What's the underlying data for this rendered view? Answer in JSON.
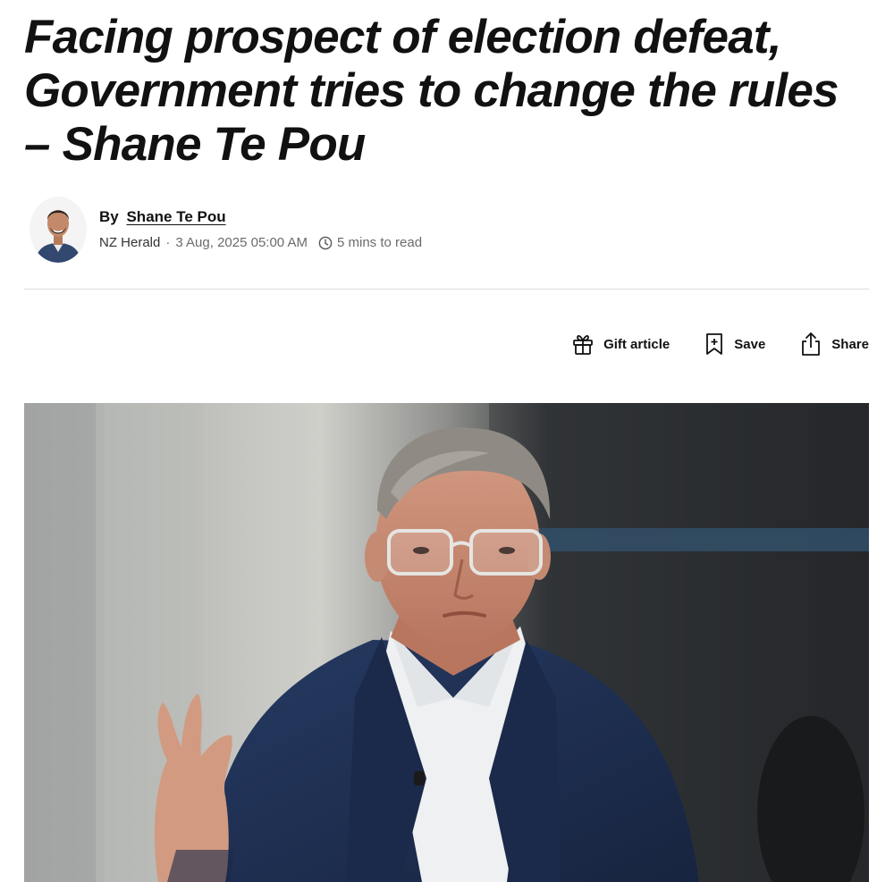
{
  "article": {
    "headline": "Facing prospect of election defeat, Government tries to change the rules – Shane Te Pou"
  },
  "byline": {
    "prefix": "By",
    "author": "Shane Te Pou",
    "source": "NZ Herald",
    "separator": "·",
    "date": "3 Aug, 2025 05:00 AM",
    "read_time": "5 mins to read"
  },
  "actions": {
    "gift_label": "Gift article",
    "save_label": "Save",
    "share_label": "Share"
  },
  "icons": {
    "gift": "gift-icon",
    "save": "bookmark-plus-icon",
    "share": "share-icon",
    "clock": "clock-icon"
  },
  "colors": {
    "text": "#111111",
    "meta": "#6b6b6b",
    "divider": "#dcdcdc",
    "suit": "#1f2d4c"
  }
}
